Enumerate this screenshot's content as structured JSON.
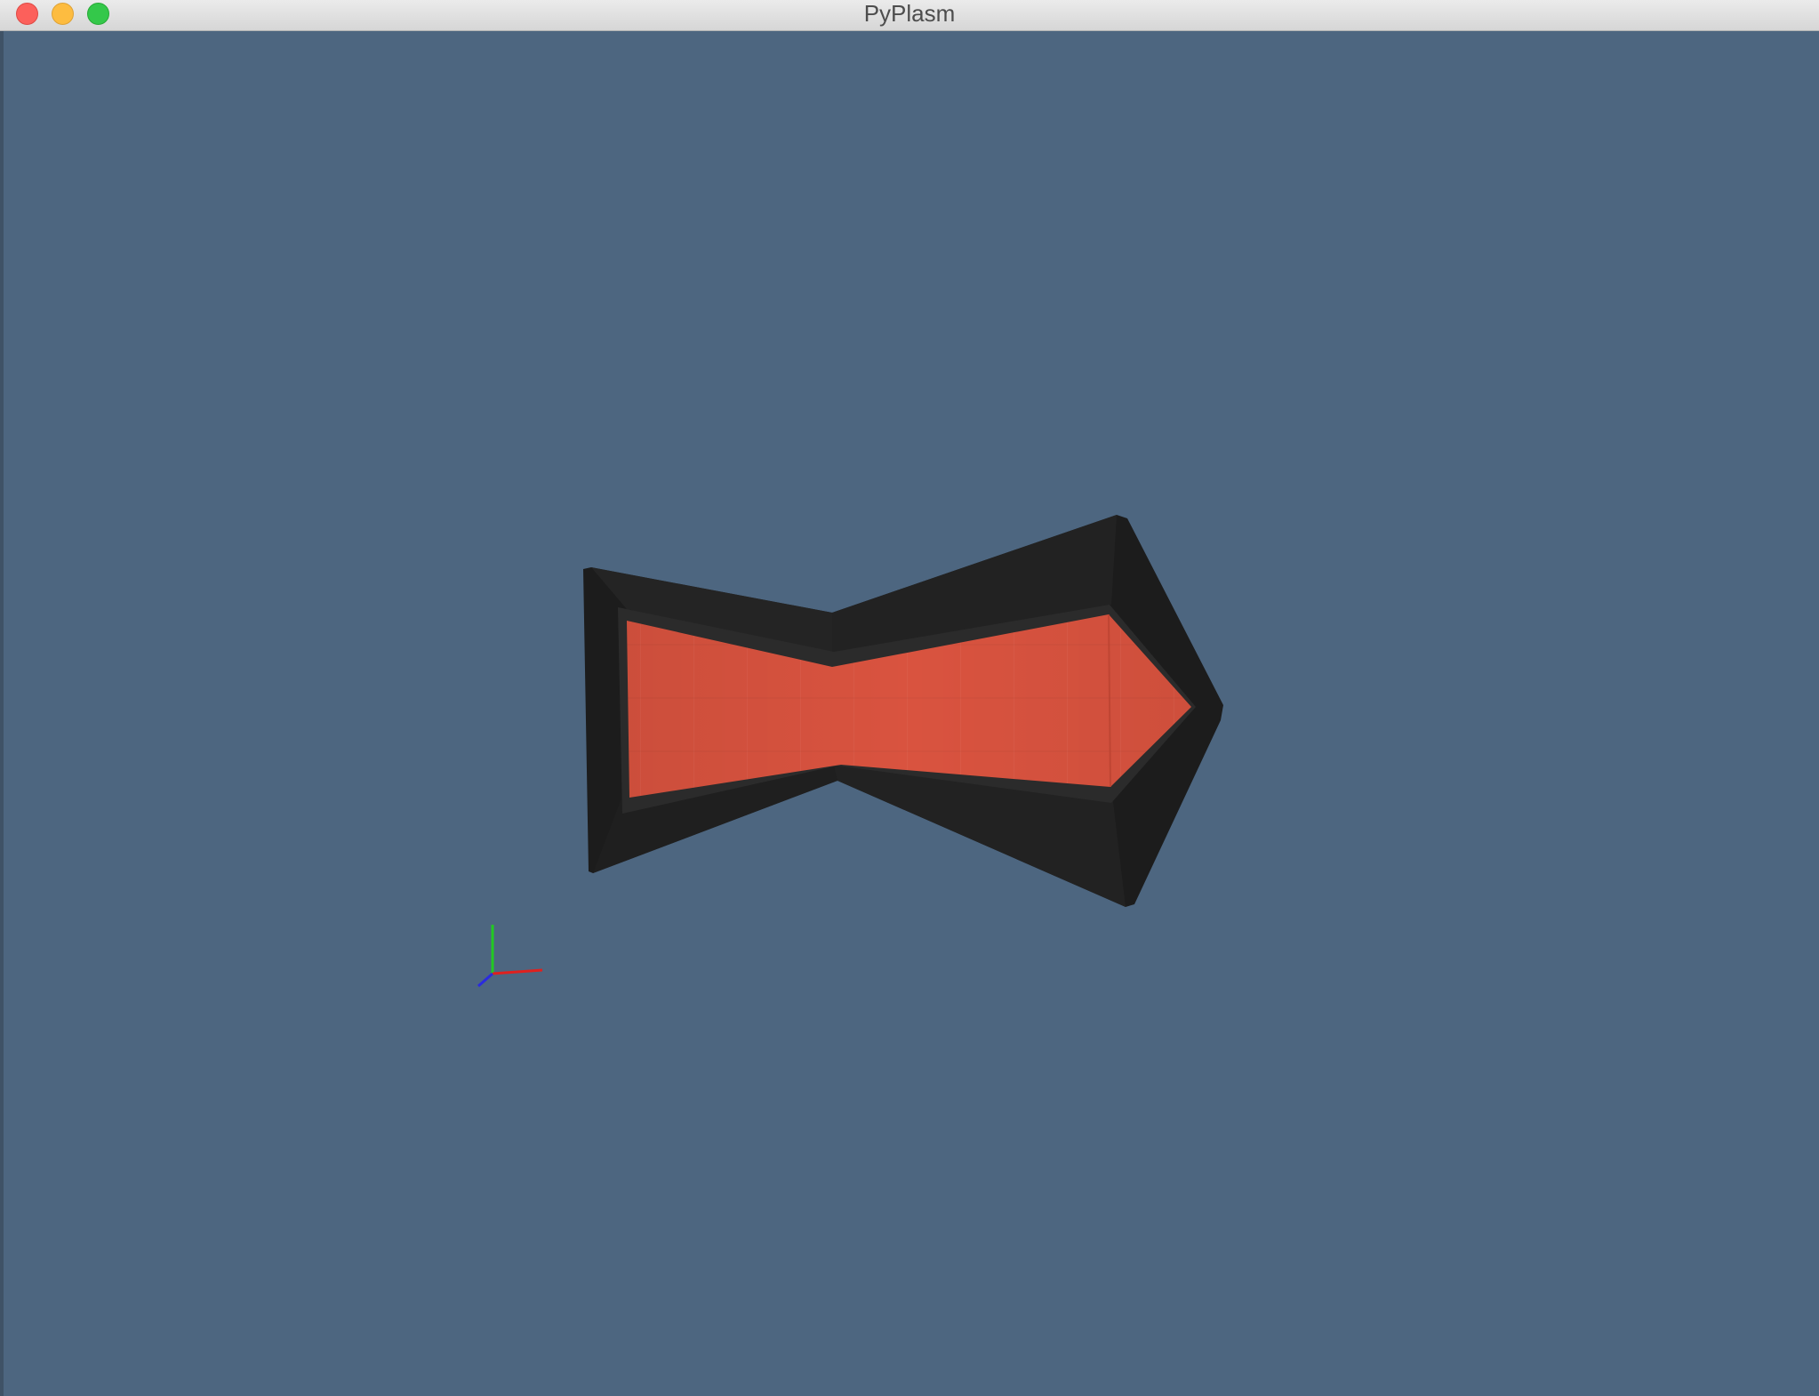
{
  "window": {
    "title": "PyPlasm"
  },
  "colors": {
    "viewport_background": "#4d6680",
    "outer_shell": "#1c1c1c",
    "inner_shell": "#2b2b2b",
    "core_fill": "#d9533f",
    "axis_x": "#e0201e",
    "axis_y": "#22c922",
    "axis_z": "#2a2ae0"
  },
  "icons": {
    "close": "close-icon",
    "minimize": "minimize-icon",
    "maximize": "maximize-icon"
  }
}
